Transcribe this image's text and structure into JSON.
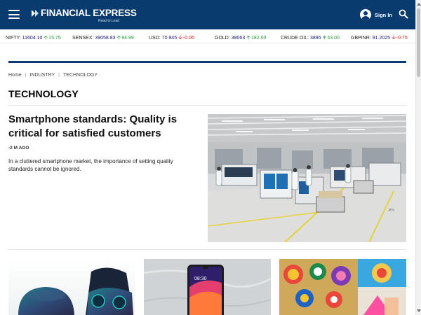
{
  "header": {
    "brand": "FINANCIAL EXPRESS",
    "tagline": "Read to Lead",
    "signin_label": "Sign In",
    "bg_color": "#0a3b6e",
    "menu_icon": "hamburger-icon",
    "search_icon": "search-icon",
    "user_icon": "user-icon"
  },
  "ticker": [
    {
      "name": "NIFTY:",
      "value": "11604.10",
      "change": "15.75",
      "dir": "up"
    },
    {
      "name": "SENSEX:",
      "value": "39058.83",
      "change": "94.99",
      "dir": "up"
    },
    {
      "name": "USD:",
      "value": "70.945",
      "change": "-0.06",
      "dir": "down"
    },
    {
      "name": "GOLD:",
      "value": "38063",
      "change": "182.00",
      "dir": "up"
    },
    {
      "name": "CRUDE OIL:",
      "value": "3895",
      "change": "43.00",
      "dir": "up"
    },
    {
      "name": "GBPINR:",
      "value": "91.2025",
      "change": "-0.75",
      "dir": "down"
    }
  ],
  "breadcrumb": {
    "items": [
      "Home",
      "INDUSTRY",
      "TECHNOLOGY"
    ],
    "separator": "|"
  },
  "section": {
    "title": "TECHNOLOGY"
  },
  "lead_article": {
    "headline": "Smartphone standards: Quality is critical for satisfied customers",
    "time_ago": "-2 M AGO",
    "summary": "In a cluttered smartphone market, the importance of setting quality standards cannot be ignored.",
    "image_alt": "smartphone factory assembly line"
  },
  "thumbnails": [
    {
      "alt": "wireless earbuds"
    },
    {
      "alt": "smartphone on marble"
    },
    {
      "alt": "colorful rangoli"
    }
  ],
  "colors": {
    "brand_blue": "#0a3b6e",
    "up": "#2e9a3a",
    "down": "#d11a1a"
  }
}
